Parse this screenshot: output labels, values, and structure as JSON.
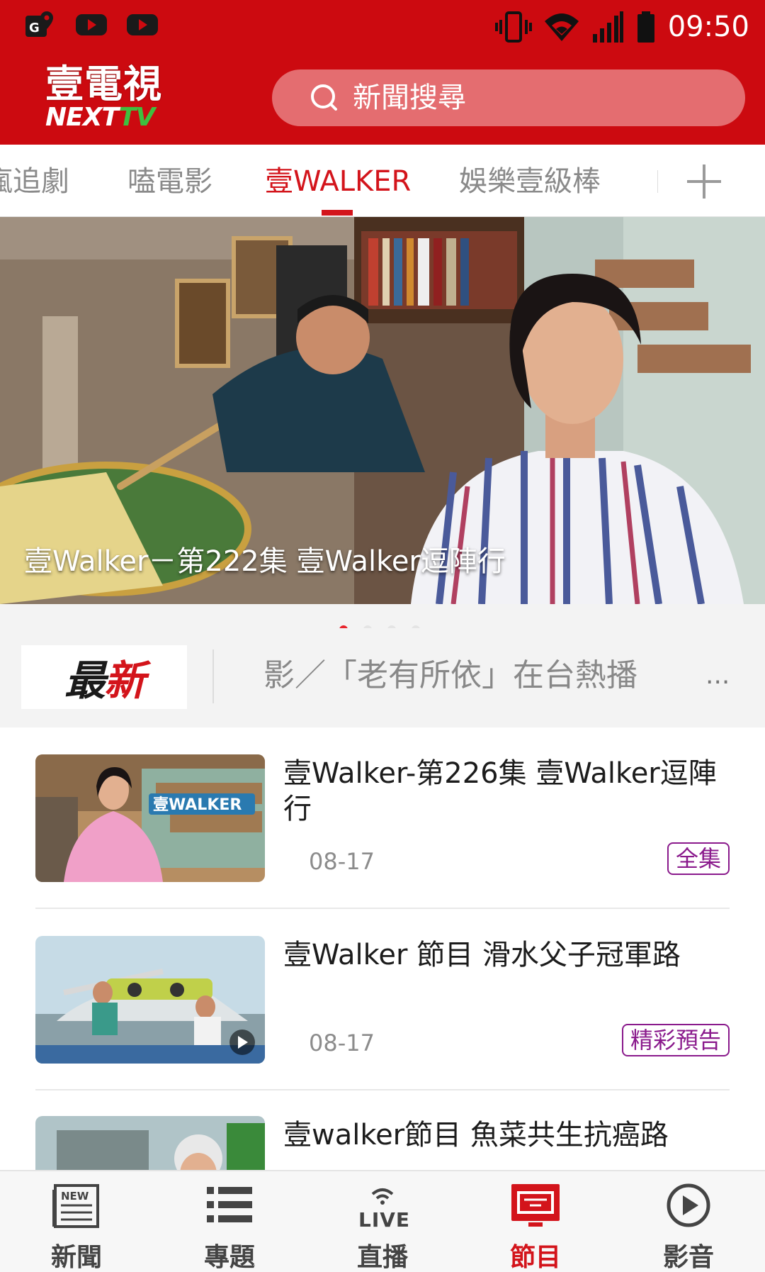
{
  "status_bar": {
    "time": "09:50"
  },
  "header": {
    "logo_cn": "壹電視",
    "logo_en_a": "NEXT",
    "logo_en_b": "TV",
    "search_placeholder": "新聞搜尋"
  },
  "tabs": [
    {
      "label": "瘋追劇"
    },
    {
      "label": "嗑電影"
    },
    {
      "label": "壹WALKER",
      "active": true
    },
    {
      "label": "娛樂壹級棒"
    }
  ],
  "hero": {
    "caption": "壹Walker－第222集 壹Walker逗陣行",
    "slides": 4,
    "active_slide": 1
  },
  "ticker": {
    "label_a": "最",
    "label_b": "新",
    "text": "影／「老有所依」在台熱播",
    "more": "..."
  },
  "list": [
    {
      "title": "壹Walker-第226集 壹Walker逗陣行",
      "date": "08-17",
      "badge": "全集",
      "thumb_text": "壹WALKER"
    },
    {
      "title": "壹Walker 節目 滑水父子冠軍路",
      "date": "08-17",
      "badge": "精彩預告"
    },
    {
      "title": "壹walker節目 魚菜共生抗癌路"
    }
  ],
  "bottom_nav": [
    {
      "label": "新聞",
      "icon": "news-icon"
    },
    {
      "label": "專題",
      "icon": "list-icon"
    },
    {
      "label": "直播",
      "icon": "live-icon"
    },
    {
      "label": "節目",
      "icon": "tv-program-icon",
      "active": true
    },
    {
      "label": "影音",
      "icon": "play-icon"
    }
  ],
  "colors": {
    "brand_red": "#cc0a10",
    "active_red": "#d3141b",
    "badge_purple": "#8a1a8c"
  }
}
